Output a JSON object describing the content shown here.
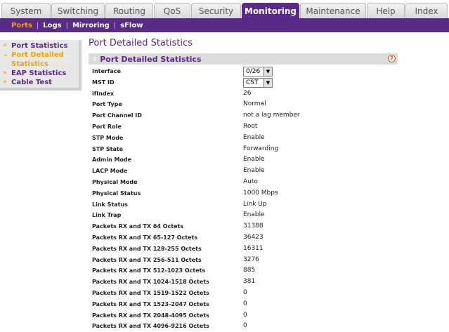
{
  "top_tabs": [
    {
      "label": "System",
      "active": false
    },
    {
      "label": "Switching",
      "active": false
    },
    {
      "label": "Routing",
      "active": false
    },
    {
      "label": "QoS",
      "active": false
    },
    {
      "label": "Security",
      "active": false
    },
    {
      "label": "Monitoring",
      "active": true
    },
    {
      "label": "Maintenance",
      "active": false
    },
    {
      "label": "Help",
      "active": false
    },
    {
      "label": "Index",
      "active": false
    }
  ],
  "sub_nav": [
    {
      "label": "Ports",
      "active": true
    },
    {
      "label": "Logs",
      "active": false
    },
    {
      "label": "Mirroring",
      "active": false
    },
    {
      "label": "sFlow",
      "active": false
    }
  ],
  "sidebar": {
    "items": [
      {
        "label": "Port Statistics",
        "arrow": "»"
      },
      {
        "label": "Port Detailed Statistics",
        "arrow": "⌄",
        "active": true
      },
      {
        "label": "EAP Statistics",
        "arrow": "»"
      },
      {
        "label": "Cable Test",
        "arrow": "»"
      }
    ]
  },
  "page_title": "Port Detailed Statistics",
  "section_title": "Port Detailed Statistics",
  "help_icon": "?",
  "interface": {
    "label": "Interface",
    "value": "0/26"
  },
  "mst": {
    "label": "MST ID",
    "value": "CST"
  },
  "stats": [
    {
      "label": "ifIndex",
      "value": "26"
    },
    {
      "label": "Port Type",
      "value": "Normal"
    },
    {
      "label": "Port Channel ID",
      "value": "not a lag member"
    },
    {
      "label": "Port Role",
      "value": "Root"
    },
    {
      "label": "STP Mode",
      "value": "Enable"
    },
    {
      "label": "STP State",
      "value": "Forwarding"
    },
    {
      "label": "Admin Mode",
      "value": "Enable"
    },
    {
      "label": "LACP Mode",
      "value": "Enable"
    },
    {
      "label": "Physical Mode",
      "value": "Auto"
    },
    {
      "label": "Physical Status",
      "value": "1000 Mbps"
    },
    {
      "label": "Link Status",
      "value": "Link Up"
    },
    {
      "label": "Link Trap",
      "value": "Enable"
    },
    {
      "label": "Packets RX and TX 64 Octets",
      "value": "31388"
    },
    {
      "label": "Packets RX and TX 65-127 Octets",
      "value": "36423"
    },
    {
      "label": "Packets RX and TX 128-255 Octets",
      "value": "16311"
    },
    {
      "label": "Packets RX and TX 256-511 Octets",
      "value": "3276"
    },
    {
      "label": "Packets RX and TX 512-1023 Octets",
      "value": "885"
    },
    {
      "label": "Packets RX and TX 1024-1518 Octets",
      "value": "381"
    },
    {
      "label": "Packets RX and TX 1519-1522 Octets",
      "value": "0"
    },
    {
      "label": "Packets RX and TX 1523-2047 Octets",
      "value": "0"
    },
    {
      "label": "Packets RX and TX 2048-4095 Octets",
      "value": "0"
    },
    {
      "label": "Packets RX and TX 4096-9216 Octets",
      "value": "0"
    }
  ],
  "colors": {
    "brand": "#5b2a86",
    "accent": "#f4a300"
  }
}
